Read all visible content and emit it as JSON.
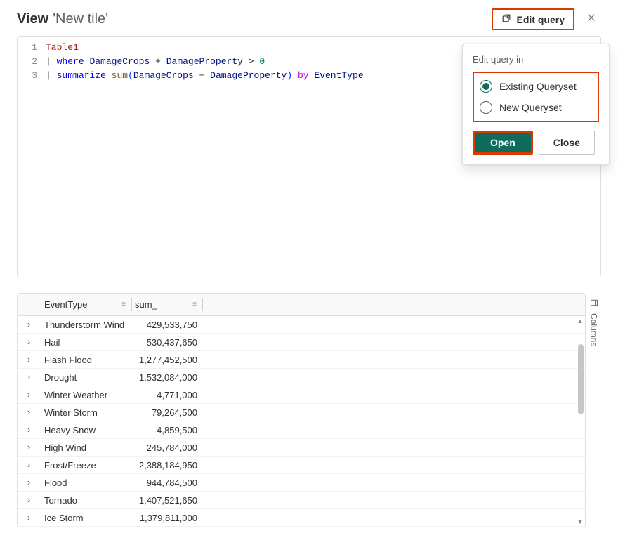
{
  "header": {
    "view_label": "View",
    "tile_name": "'New tile'",
    "edit_query_label": "Edit query"
  },
  "code": {
    "line_numbers": [
      "1",
      "2",
      "3"
    ],
    "tokens": {
      "table": "Table1",
      "pipe": "|",
      "where": "where",
      "damage_crops": "DamageCrops",
      "plus": "+",
      "damage_property": "DamageProperty",
      "gt": ">",
      "zero": "0",
      "summarize": "summarize",
      "sum": "sum",
      "lparen": "(",
      "rparen": ")",
      "by": "by",
      "event_type": "EventType"
    }
  },
  "popup": {
    "title": "Edit query in",
    "options": {
      "existing": "Existing Queryset",
      "new_q": "New Queryset"
    },
    "open_label": "Open",
    "close_label": "Close"
  },
  "table": {
    "headers": {
      "event_type": "EventType",
      "sum": "sum_"
    },
    "columns_tab": "Columns",
    "rows": [
      {
        "event": "Thunderstorm Wind",
        "sum": "429,533,750"
      },
      {
        "event": "Hail",
        "sum": "530,437,650"
      },
      {
        "event": "Flash Flood",
        "sum": "1,277,452,500"
      },
      {
        "event": "Drought",
        "sum": "1,532,084,000"
      },
      {
        "event": "Winter Weather",
        "sum": "4,771,000"
      },
      {
        "event": "Winter Storm",
        "sum": "79,264,500"
      },
      {
        "event": "Heavy Snow",
        "sum": "4,859,500"
      },
      {
        "event": "High Wind",
        "sum": "245,784,000"
      },
      {
        "event": "Frost/Freeze",
        "sum": "2,388,184,950"
      },
      {
        "event": "Flood",
        "sum": "944,784,500"
      },
      {
        "event": "Tornado",
        "sum": "1,407,521,650"
      },
      {
        "event": "Ice Storm",
        "sum": "1,379,811,000"
      }
    ]
  }
}
